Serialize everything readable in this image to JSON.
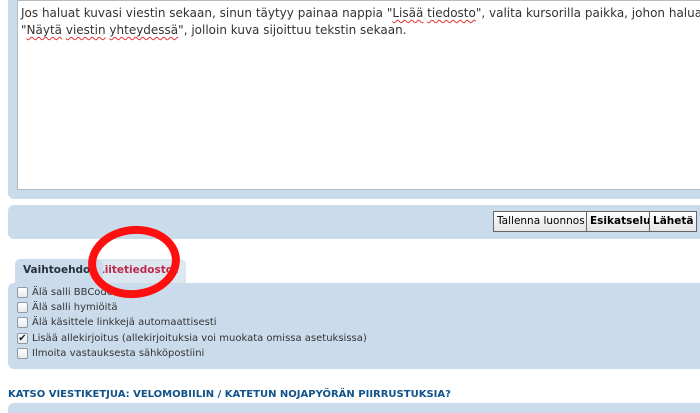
{
  "editor": {
    "line1_a": "Jos haluat kuvasi viestin sekaan, sinun täytyy painaa nappia \"",
    "line1_spell1": "Lisää",
    "line1_b": " ",
    "line1_spell2": "tiedosto",
    "line1_c": "\", valita kursorilla paikka, johon haluat kuvan lisätä j",
    "line2_a": "\"",
    "line2_spell1": "Näytä",
    "line2_b": " ",
    "line2_spell2": "viestin",
    "line2_c": " ",
    "line2_spell3": "yhteydessä",
    "line2_d": "\", jolloin kuva sijoittuu tekstin sekaan."
  },
  "buttons": {
    "save_draft": "Tallenna luonnos",
    "preview": "Esikatselu",
    "submit": "Lähetä"
  },
  "tabs": {
    "options": "Vaihtoehdot",
    "attachments": "Liitetiedostot"
  },
  "options": [
    {
      "label": "Älä salli BBCode",
      "checked": false
    },
    {
      "label": "Älä salli hymiöitä",
      "checked": false
    },
    {
      "label": "Älä käsittele linkkejä automaattisesti",
      "checked": false
    },
    {
      "label": "Lisää allekirjoitus (allekirjoituksia voi muokata omissa asetuksissa)",
      "checked": true
    },
    {
      "label": "Ilmoita vastauksesta sähköpostiini",
      "checked": false
    }
  ],
  "topic": {
    "link": "KATSO VIESTIKETJUA: VELOMOBIILIN / KATETUN NOJAPYÖRÄN PIIRRUSTUKSIA?"
  },
  "colors": {
    "panel": "#cadceb",
    "annotation": "#ff1010",
    "link": "#105289",
    "tab_inactive_text": "#bc2a4d"
  }
}
